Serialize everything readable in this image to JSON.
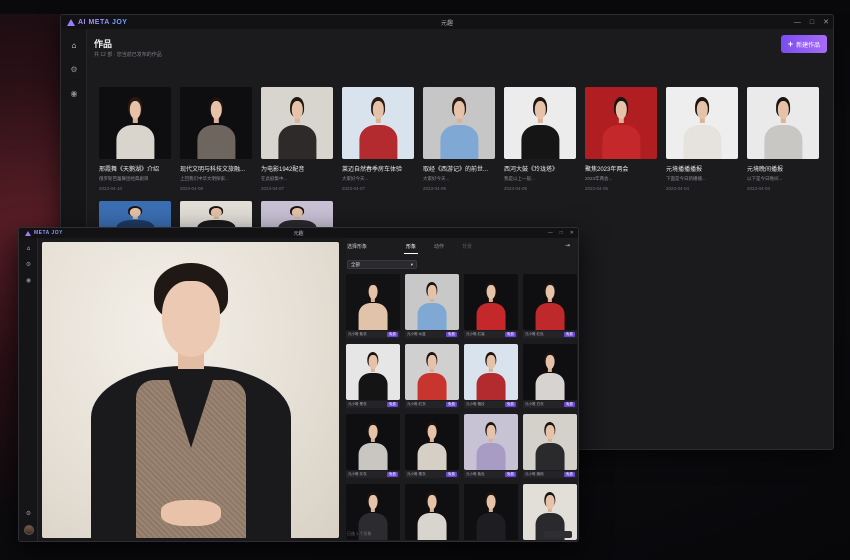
{
  "back_window": {
    "logo": "AI META JOY",
    "title": "元趣",
    "controls": [
      "—",
      "□",
      "✕"
    ],
    "nav": [
      {
        "icon": "home-icon",
        "glyph": "⌂"
      },
      {
        "icon": "settings-icon",
        "glyph": "⚙"
      },
      {
        "icon": "record-icon",
        "glyph": "◉"
      }
    ],
    "section_title": "作品",
    "section_sub": "共 12 部 · 您当前已发布的作品",
    "new_button": "新建作品",
    "cards": [
      {
        "title": "邢霞舞《天鹅湖》介绍",
        "desc": "俄罗斯芭蕾舞团经典剧目",
        "date": "2023-04-10",
        "bg": "#0e0e10",
        "cloth": "#d9d5cc",
        "hair": "#2b1a12"
      },
      {
        "title": "现代文明与科技文旅融...",
        "desc": "上回我们中华文明探索...",
        "date": "2023-04-08",
        "bg": "#0e0e10",
        "cloth": "#6d655e",
        "hair": "#1c1410"
      },
      {
        "title": "为电影1942配音",
        "desc": "在此剧集中...",
        "date": "2023-04-07",
        "bg": "#d8d4ce",
        "cloth": "#2d2a29",
        "hair": "#1e1712"
      },
      {
        "title": "莱迈自然春季房车体验",
        "desc": "大家好今天...",
        "date": "2023-04-07",
        "bg": "#d8e3ee",
        "cloth": "#b32b2e",
        "hair": "#2a1c14"
      },
      {
        "title": "取经《西游记》的前世...",
        "desc": "大家好今天...",
        "date": "2023-04-05",
        "bg": "#c6c6c6",
        "cloth": "#7fa8d4",
        "hair": "#2b1a12"
      },
      {
        "title": "西河大鼓《玲珑塔》",
        "desc": "我是以上一般...",
        "date": "2023-04-05",
        "bg": "#ececec",
        "cloth": "#151515",
        "hair": "#1d1410"
      },
      {
        "title": "聚焦2023年两会",
        "desc": "2023年两会...",
        "date": "2023-04-05",
        "bg": "#b01e22",
        "cloth": "#c5282a",
        "hair": "#1c1410"
      },
      {
        "title": "元境播播播报",
        "desc": "下面是今日新播播...",
        "date": "2023-04-04",
        "bg": "#eeeeee",
        "cloth": "#e6e2de",
        "hair": "#1b1410"
      },
      {
        "title": "元境晚间播报",
        "desc": "以下是今日晚间...",
        "date": "2023-04-04",
        "bg": "#eaeaea",
        "cloth": "#c9c7c4",
        "hair": "#1b1410"
      }
    ],
    "cards_row2": [
      {
        "bg": "#3b6fb4",
        "cloth": "#1e3b66",
        "hair": "#1c1410"
      },
      {
        "bg": "#e2ded8",
        "cloth": "#1a1a1a",
        "hair": "#1c1410"
      },
      {
        "bg": "#c9c2d6",
        "cloth": "#2b2a2f",
        "hair": "#1c1410"
      }
    ]
  },
  "front_window": {
    "logo": "META JOY",
    "title": "元趣",
    "controls": [
      "—",
      "□",
      "✕"
    ],
    "nav": [
      {
        "icon": "home-icon",
        "glyph": "⌂"
      },
      {
        "icon": "settings-icon",
        "glyph": "⚙"
      },
      {
        "icon": "record-icon",
        "glyph": "◉"
      }
    ],
    "panel_title": "选择形象",
    "tabs": [
      {
        "label": "形象",
        "state": "active"
      },
      {
        "label": "动作",
        "state": "normal"
      },
      {
        "label": "背景",
        "state": "disabled"
      }
    ],
    "dropdown": "全部",
    "tag": "免费",
    "footer": "已选 1 个形象",
    "avatars": [
      {
        "name": "元小唯·紫衣",
        "bg": "#121214",
        "cloth": "#e0c3a8"
      },
      {
        "name": "元小唯·水蓝",
        "bg": "#c8c8c8",
        "cloth": "#7fa8d4"
      },
      {
        "name": "元小唯·红装",
        "bg": "#0f0f11",
        "cloth": "#c5282a"
      },
      {
        "name": "元小唯·红色",
        "bg": "#0f0f11",
        "cloth": "#c0292c"
      },
      {
        "name": "元小唯·黑衣",
        "bg": "#e6e6e6",
        "cloth": "#141414"
      },
      {
        "name": "元小唯·红衣",
        "bg": "#d0d0d0",
        "cloth": "#c8352e"
      },
      {
        "name": "元小唯·格纹",
        "bg": "#d8e3ee",
        "cloth": "#b32b2e"
      },
      {
        "name": "元小唯·白衣",
        "bg": "#0f0f11",
        "cloth": "#d7d3d0"
      },
      {
        "name": "元小唯·灰衣",
        "bg": "#0f0f11",
        "cloth": "#c9c6c2"
      },
      {
        "name": "元小唯·素衣",
        "bg": "#0f0f11",
        "cloth": "#d6cfc6"
      },
      {
        "name": "元小唯·紫色",
        "bg": "#c7c2d4",
        "cloth": "#a89cc4"
      },
      {
        "name": "元小唯·旗袍",
        "bg": "#d4d0ca",
        "cloth": "#2a2a2c"
      },
      {
        "name": "元小唯·西装",
        "bg": "#0f0f11",
        "cloth": "#2c2c30"
      },
      {
        "name": "元小唯·条纹",
        "bg": "#0f0f11",
        "cloth": "#d8d4ce"
      },
      {
        "name": "元小唯·正装",
        "bg": "#0f0f11",
        "cloth": "#1e1e22"
      },
      {
        "name": "元小唯·马甲",
        "bg": "#e2ded8",
        "cloth": "#2a2a2c"
      }
    ]
  }
}
